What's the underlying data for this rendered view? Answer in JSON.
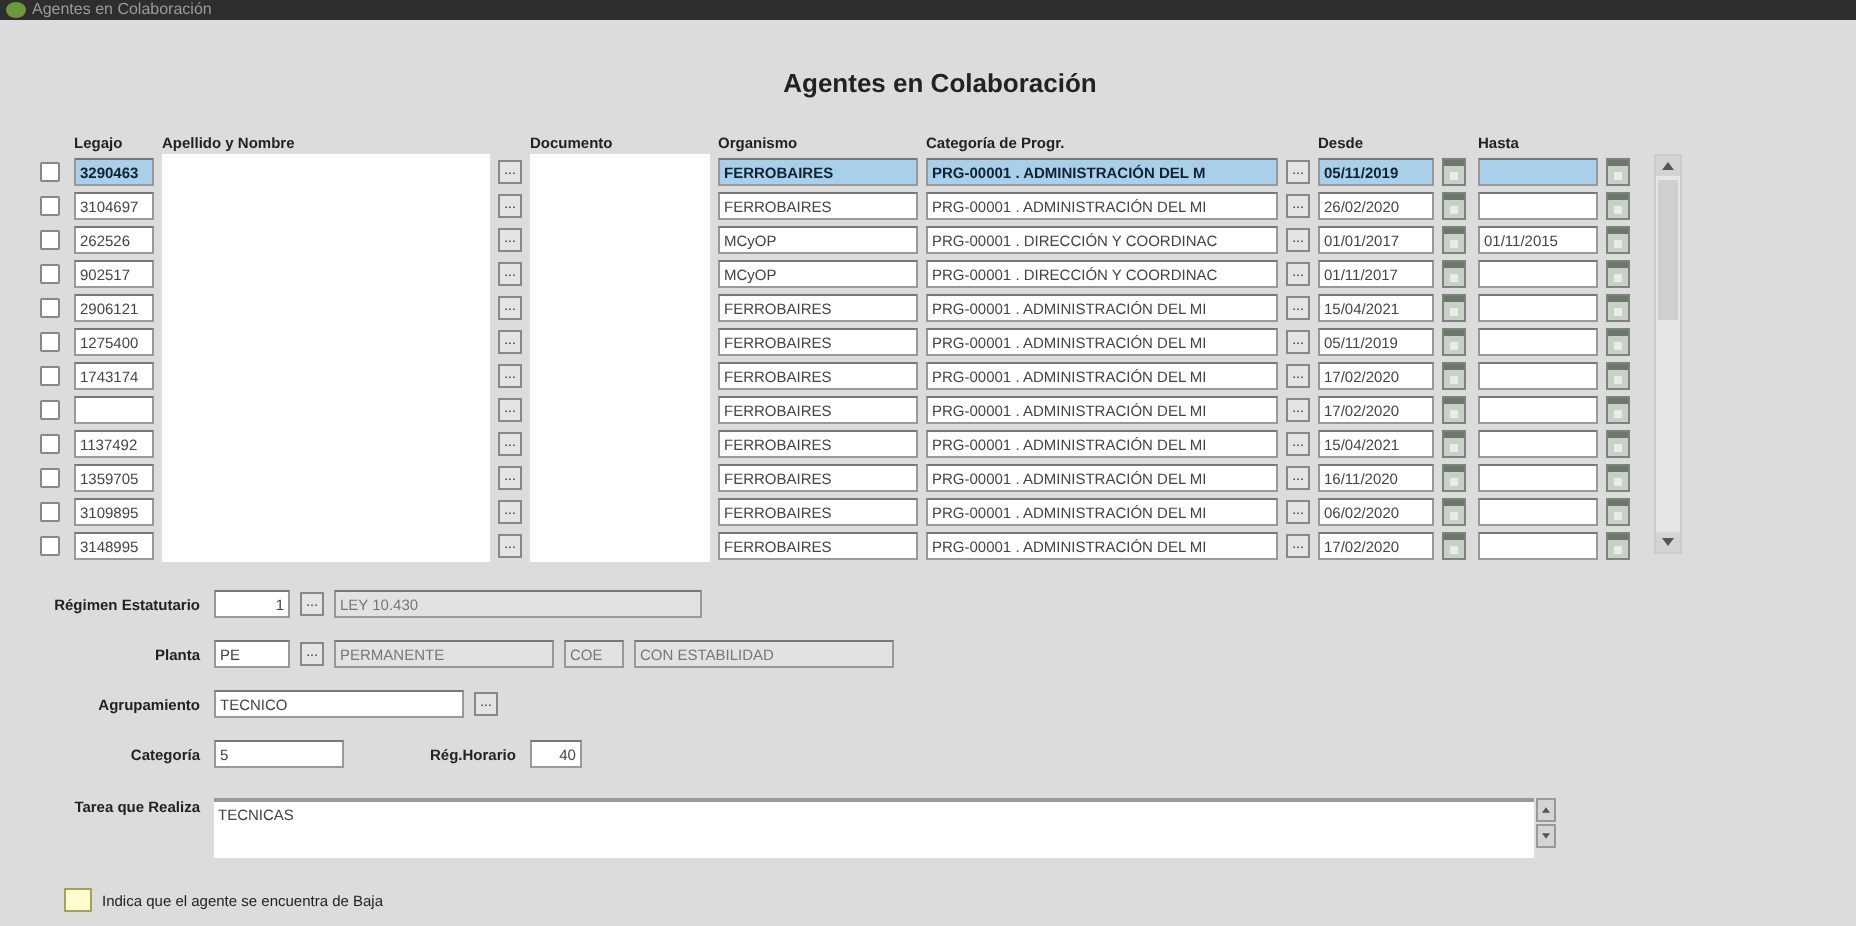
{
  "window": {
    "title": "Agentes en Colaboración"
  },
  "heading": "Agentes en Colaboración",
  "columns": [
    "Legajo",
    "Apellido y Nombre",
    "Documento",
    "Organismo",
    "Categoría de Progr.",
    "Desde",
    "Hasta"
  ],
  "rows": [
    {
      "checked": false,
      "selected": true,
      "legajo": "3290463",
      "organismo": "FERROBAIRES",
      "categoria": "PRG-00001 . ADMINISTRACIÓN DEL M",
      "desde": "05/11/2019",
      "hasta": ""
    },
    {
      "checked": false,
      "selected": false,
      "legajo": "3104697",
      "organismo": "FERROBAIRES",
      "categoria": "PRG-00001 . ADMINISTRACIÓN DEL MI",
      "desde": "26/02/2020",
      "hasta": ""
    },
    {
      "checked": false,
      "selected": false,
      "legajo": "262526",
      "organismo": "MCyOP",
      "categoria": "PRG-00001 . DIRECCIÓN Y COORDINAC",
      "desde": "01/01/2017",
      "hasta": "01/11/2015"
    },
    {
      "checked": false,
      "selected": false,
      "legajo": "902517",
      "organismo": "MCyOP",
      "categoria": "PRG-00001 . DIRECCIÓN Y COORDINAC",
      "desde": "01/11/2017",
      "hasta": ""
    },
    {
      "checked": false,
      "selected": false,
      "legajo": "2906121",
      "organismo": "FERROBAIRES",
      "categoria": "PRG-00001 . ADMINISTRACIÓN DEL MI",
      "desde": "15/04/2021",
      "hasta": ""
    },
    {
      "checked": false,
      "selected": false,
      "legajo": "1275400",
      "organismo": "FERROBAIRES",
      "categoria": "PRG-00001 . ADMINISTRACIÓN DEL MI",
      "desde": "05/11/2019",
      "hasta": ""
    },
    {
      "checked": false,
      "selected": false,
      "legajo": "1743174",
      "organismo": "FERROBAIRES",
      "categoria": "PRG-00001 . ADMINISTRACIÓN DEL MI",
      "desde": "17/02/2020",
      "hasta": ""
    },
    {
      "checked": false,
      "selected": false,
      "legajo": "",
      "organismo": "FERROBAIRES",
      "categoria": "PRG-00001 . ADMINISTRACIÓN DEL MI",
      "desde": "17/02/2020",
      "hasta": ""
    },
    {
      "checked": false,
      "selected": false,
      "legajo": "1137492",
      "organismo": "FERROBAIRES",
      "categoria": "PRG-00001 . ADMINISTRACIÓN DEL MI",
      "desde": "15/04/2021",
      "hasta": ""
    },
    {
      "checked": false,
      "selected": false,
      "legajo": "1359705",
      "organismo": "FERROBAIRES",
      "categoria": "PRG-00001 . ADMINISTRACIÓN DEL MI",
      "desde": "16/11/2020",
      "hasta": ""
    },
    {
      "checked": false,
      "selected": false,
      "legajo": "3109895",
      "organismo": "FERROBAIRES",
      "categoria": "PRG-00001 . ADMINISTRACIÓN DEL MI",
      "desde": "06/02/2020",
      "hasta": ""
    },
    {
      "checked": false,
      "selected": false,
      "legajo": "3148995",
      "organismo": "FERROBAIRES",
      "categoria": "PRG-00001 . ADMINISTRACIÓN DEL MI",
      "desde": "17/02/2020",
      "hasta": ""
    }
  ],
  "lov_button": "...",
  "regimen": {
    "label": "Régimen Estatutario",
    "code": "1",
    "description": "LEY 10.430"
  },
  "planta": {
    "label": "Planta",
    "code": "PE",
    "description": "PERMANENTE",
    "subcode": "COE",
    "subdescription": "CON ESTABILIDAD"
  },
  "agrupamiento": {
    "label": "Agrupamiento",
    "value": "TECNICO"
  },
  "categoria": {
    "label": "Categoría",
    "value": "5"
  },
  "regimen_horario": {
    "label": "Rég.Horario",
    "value": "40"
  },
  "tarea": {
    "label": "Tarea que Realiza",
    "value": "TECNICAS"
  },
  "baja": {
    "checked": false,
    "label": "Indica que el agente se encuentra de Baja"
  }
}
